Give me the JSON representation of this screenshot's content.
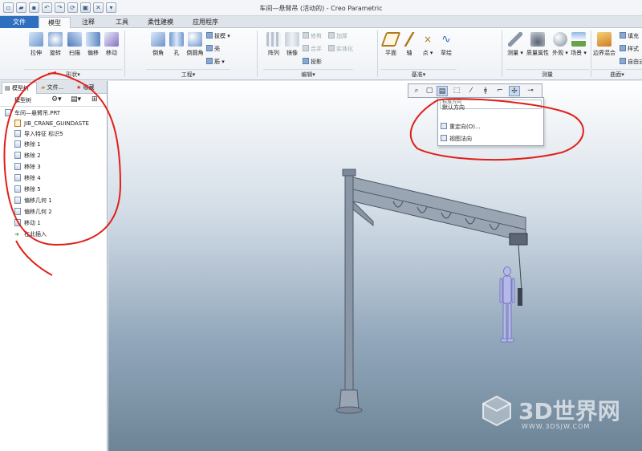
{
  "window": {
    "title": "车间—悬臂吊 (活动的) - Creo Parametric"
  },
  "tabs": [
    {
      "label": "文件"
    },
    {
      "label": "模型"
    },
    {
      "label": "注释"
    },
    {
      "label": "工具"
    },
    {
      "label": "柔性建模"
    },
    {
      "label": "应用程序"
    }
  ],
  "ribbon": {
    "shape": {
      "group": "形状▾",
      "buttons": [
        "拉伸",
        "旋转",
        "扫描",
        "偏移",
        "移动"
      ]
    },
    "engineering": {
      "group": "工程▾",
      "buttons": [
        "倒角",
        "孔",
        "倒圆角"
      ],
      "small": [
        "拔模",
        "壳",
        "筋"
      ]
    },
    "editing": {
      "group": "编辑▾",
      "buttons": [
        "阵列",
        "镜像"
      ],
      "small": [
        "修剪",
        "加厚",
        "合并",
        "实体化",
        "投影"
      ]
    },
    "datum": {
      "group": "基准▾",
      "buttons": [
        "平面",
        "轴",
        "点",
        "草绘"
      ]
    },
    "measure": {
      "group": "测量",
      "buttons": [
        "测量",
        "质量属性",
        "外观",
        "场景"
      ]
    },
    "surfaces": {
      "group": "曲面▾",
      "buttons": [
        "边界混合"
      ],
      "small": [
        "填充",
        "样式",
        "自由式"
      ]
    }
  },
  "panel": {
    "tabs": [
      "模型树",
      "文件...",
      "收藏"
    ],
    "toolbar_label": "模型树",
    "tree": [
      "车间—悬臂吊.PRT",
      "JIB_CRANE_GUINDASTE",
      "导入特征 标识5",
      "移除 1",
      "移除 2",
      "移除 3",
      "移除 4",
      "移除 5",
      "偏移几何 1",
      "偏移几何 2",
      "移动 1",
      "在此插入"
    ]
  },
  "viewport": {
    "dropdown": {
      "input_value": "默认方向",
      "hint": "标准方向",
      "items": [
        "重定向(O)...",
        "视图法向"
      ]
    }
  },
  "watermark": {
    "brand": "3D世界网",
    "url": "WWW.3DSJW.COM"
  },
  "colors": {
    "file_tab": "#2f6fbf",
    "annotation": "#e0201a",
    "model": "#8a96a6",
    "mannequin": "#b5b8e8"
  }
}
